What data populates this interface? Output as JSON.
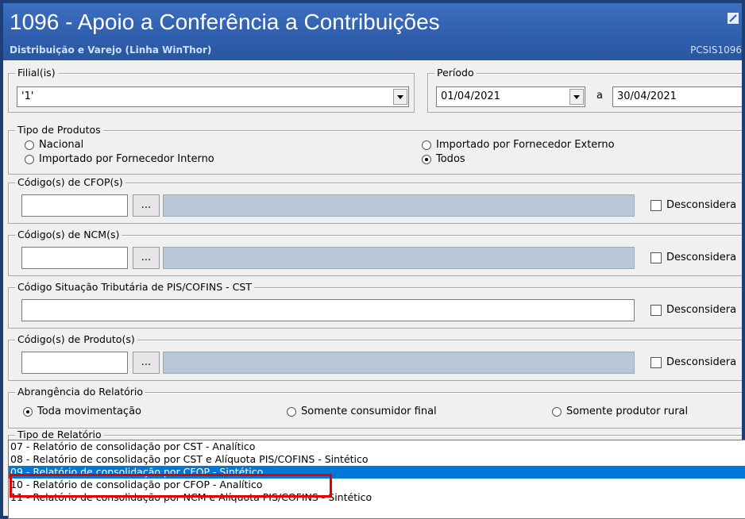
{
  "window": {
    "title": "1096 - Apoio a Conferência a Contribuições",
    "subtitle": "Distribuição e Varejo (Linha WinThor)",
    "code": "PCSIS1096"
  },
  "filial": {
    "legend": "Filial(is)",
    "value": "'1'"
  },
  "periodo": {
    "legend": "Período",
    "start": "01/04/2021",
    "separator": "a",
    "end": "30/04/2021"
  },
  "tipo_produtos": {
    "legend": "Tipo de Produtos",
    "options": [
      "Nacional",
      "Importado por Fornecedor Interno",
      "Importado por Fornecedor Externo",
      "Todos"
    ],
    "selected": "Todos"
  },
  "cfop": {
    "legend": "Código(s) de CFOP(s)",
    "browse": "...",
    "disregard": "Desconsidera"
  },
  "ncm": {
    "legend": "Código(s) de NCM(s)",
    "browse": "...",
    "disregard": "Desconsidera"
  },
  "cst": {
    "legend": "Código Situação Tributária de PIS/COFINS - CST",
    "disregard": "Desconsidera"
  },
  "produto": {
    "legend": "Código(s) de Produto(s)",
    "browse": "...",
    "disregard": "Desconsidera"
  },
  "abrangencia": {
    "legend": "Abrangência do Relatório",
    "options": [
      "Toda movimentação",
      "Somente consumidor final",
      "Somente produtor rural"
    ],
    "selected": "Toda movimentação"
  },
  "tipo_relatorio": {
    "legend": "Tipo de Relatório",
    "items": [
      "07 - Relatório de consolidação por CST - Analítico",
      "08 - Relatório de consolidação por CST e Alíquota PIS/COFINS - Sintético",
      "09 - Relatório de consolidação por CFOP - Sintético",
      "10 - Relatório de consolidação por CFOP - Analítico",
      "11 - Relatório de consolidação por NCM e Alíquota PIS/COFINS - Sintético"
    ],
    "selected_index": 2
  },
  "colors": {
    "header": "#2f5fae",
    "selection": "#0078d7",
    "highlight": "#e00000",
    "readonly": "#b8c7d6"
  }
}
